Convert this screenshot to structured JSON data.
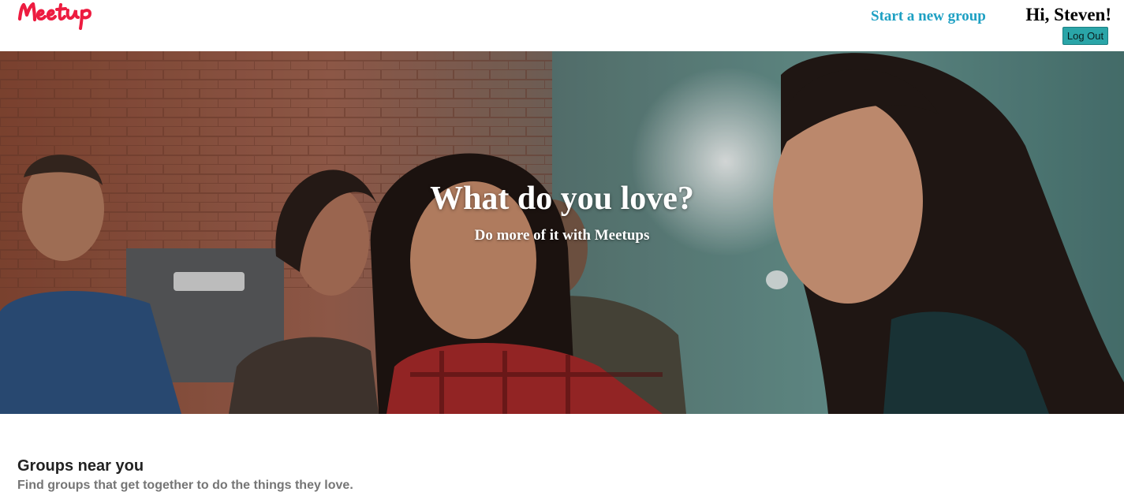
{
  "header": {
    "logo_text": "Meetup",
    "start_group_label": "Start a new group",
    "greeting": "Hi, Steven!",
    "logout_label": "Log Out"
  },
  "hero": {
    "title": "What do you love?",
    "subtitle": "Do more of it with Meetups"
  },
  "groups_section": {
    "title": "Groups near you",
    "subtitle": "Find groups that get together to do the things they love."
  },
  "colors": {
    "brand": "#ed1c40",
    "link": "#1ea0c3",
    "logout_button": "#2aa5a8"
  }
}
